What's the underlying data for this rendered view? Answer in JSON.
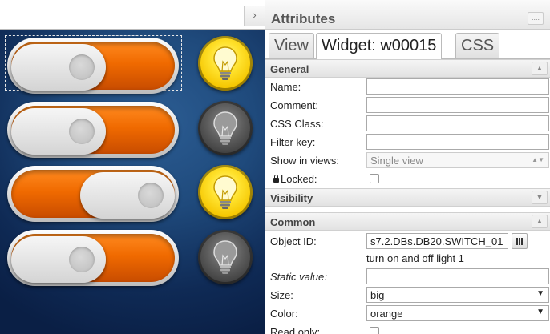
{
  "left": {
    "collapse_icon": "›",
    "widgets": [
      {
        "switch_state": "off",
        "lamp_state": "on",
        "selected": true
      },
      {
        "switch_state": "off",
        "lamp_state": "off",
        "selected": false
      },
      {
        "switch_state": "on",
        "lamp_state": "on",
        "selected": false
      },
      {
        "switch_state": "off",
        "lamp_state": "off",
        "selected": false
      }
    ]
  },
  "panel": {
    "title": "Attributes",
    "menu_icon": "....",
    "tabs": [
      "View",
      "Widget: w00015",
      "CSS"
    ],
    "active_tab": "Widget: w00015",
    "general": {
      "title": "General",
      "collapse_icon": "▲",
      "name_label": "Name:",
      "name_value": "",
      "comment_label": "Comment:",
      "comment_value": "",
      "css_class_label": "CSS Class:",
      "css_class_value": "",
      "filter_key_label": "Filter key:",
      "filter_key_value": "",
      "show_in_views_label": "Show in views:",
      "show_in_views_value": "Single view",
      "locked_label": "Locked:",
      "locked_checked": false
    },
    "visibility": {
      "title": "Visibility",
      "expand_icon": "▼"
    },
    "common": {
      "title": "Common",
      "collapse_icon": "▲",
      "object_id_label": "Object ID:",
      "object_id_value": "s7.2.DBs.DB20.SWITCH_01",
      "object_id_description": "turn on and off light 1",
      "static_value_label": "Static value:",
      "static_value_value": "",
      "size_label": "Size:",
      "size_value": "big",
      "color_label": "Color:",
      "color_value": "orange",
      "read_only_label": "Read only:",
      "read_only_checked": false
    }
  },
  "colors": {
    "accent_orange": "#f06a00",
    "lamp_on": "#ffe22e",
    "lamp_off": "#5a5a5a",
    "canvas_bg": "#1f4a7c"
  }
}
